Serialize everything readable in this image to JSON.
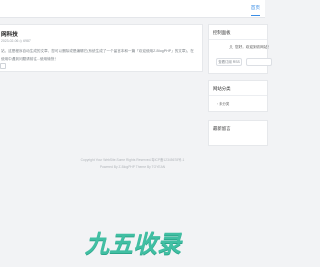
{
  "nav": {
    "home_label": "首页"
  },
  "post": {
    "title": "网科技",
    "meta": "2023-02-06  ◎ 6987",
    "excerpt": "站，这是程序自动生成的文章，您可以删除或是编辑它(系统生成了一个留言本和一篇「欢迎使用Z-BlogPHP」的文章)，在使用中遇到问题请前往...使用愉快！"
  },
  "sidebar": {
    "control_panel": {
      "title": "控制面板",
      "welcome": "您好，欢迎到访网站！",
      "subscribe_label": "查看订阅 RSS"
    },
    "categories": {
      "title": "网站分类",
      "items": [
        "未分类"
      ]
    },
    "recent_comments": {
      "title": "最新留言"
    }
  },
  "footer": {
    "copyright": "Copyright Your WebSite.Some Rights Reserved.粤ICP备12345678号-1",
    "powered_by": "Powered By Z-BlogPHP  Theme By TOYEAN"
  },
  "brand": {
    "logo_text": "九五收录"
  },
  "colors": {
    "accent": "#3a8ee6",
    "logo": "#41bfa3",
    "background": "#f2f3f5"
  }
}
